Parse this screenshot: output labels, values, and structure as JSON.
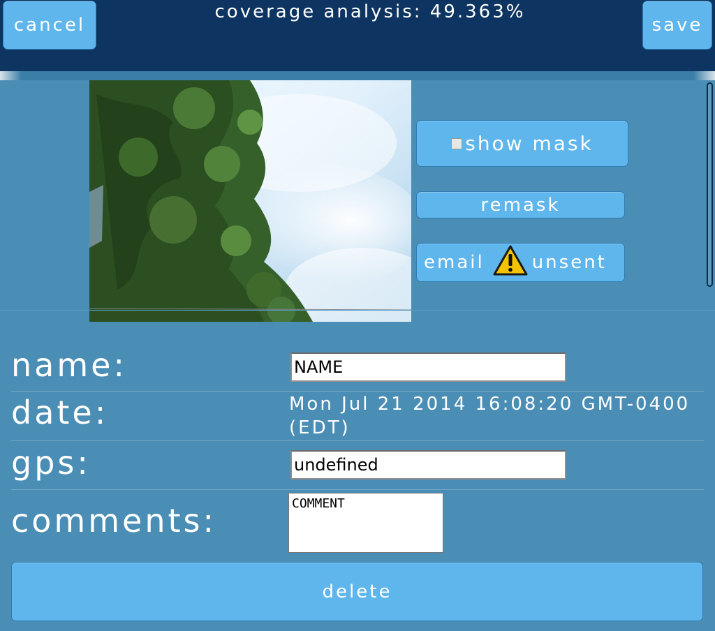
{
  "header": {
    "title": "coverage analysis: 49.363%",
    "cancel_label": "cancel",
    "save_label": "save"
  },
  "actions": {
    "show_mask_label": "show mask",
    "show_mask_checked": false,
    "remask_label": "remask",
    "email_label": "email",
    "email_status": "unsent",
    "email_status_icon": "warning-icon"
  },
  "form": {
    "name_label": "name:",
    "name_value": "NAME",
    "date_label": "date:",
    "date_value": "Mon Jul 21 2014 16:08:20 GMT-0400 (EDT)",
    "gps_label": "gps:",
    "gps_value": "undefined",
    "comments_label": "comments:",
    "comments_value": "COMMENT"
  },
  "footer": {
    "delete_label": "delete"
  },
  "colors": {
    "header_bg": "#0e3461",
    "page_bg": "#4a8db5",
    "button_bg": "#5fb6ec",
    "warning_yellow": "#f5c400"
  }
}
